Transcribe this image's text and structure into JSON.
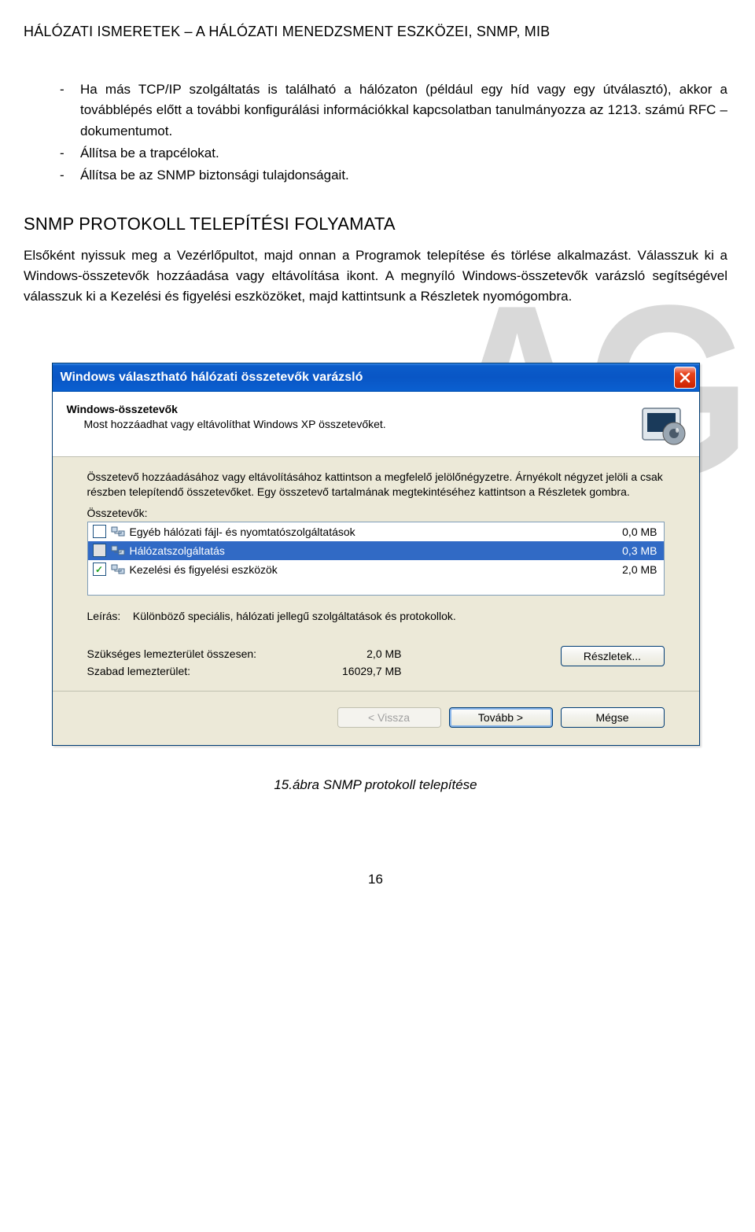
{
  "doc": {
    "header": "HÁLÓZATI ISMERETEK – A HÁLÓZATI MENEDZSMENT ESZKÖZEI, SNMP, MIB",
    "bullets": [
      "Ha más TCP/IP szolgáltatás is található a hálózaton (például egy híd vagy egy útválasztó), akkor a továbblépés előtt a további konfigurálási információkkal kapcsolatban tanulmányozza az 1213. számú RFC – dokumentumot.",
      "Állítsa be a trapcélokat.",
      "Állítsa be az SNMP biztonsági tulajdonságait."
    ],
    "section_heading": "SNMP PROTOKOLL TELEPÍTÉSI FOLYAMATA",
    "para1": "Elsőként nyissuk meg a Vezérlőpultot, majd onnan a Programok telepítése és törlése alkalmazást. Válasszuk ki a Windows-összetevők hozzáadása vagy eltávolítása ikont. A megnyíló Windows-összetevők varázsló segítségével válasszuk ki a Kezelési és figyelési eszközöket, majd kattintsunk a Részletek nyomógombra.",
    "caption": "15.ábra SNMP protokoll telepítése",
    "pagenum": "16",
    "watermark": "AG"
  },
  "dialog": {
    "title": "Windows választható hálózati összetevők varázsló",
    "banner_title": "Windows-összetevők",
    "banner_sub": "Most hozzáadhat vagy eltávolíthat Windows XP összetevőket.",
    "instructions": "Összetevő hozzáadásához vagy eltávolításához kattintson a megfelelő jelölőnégyzetre. Árnyékolt négyzet jelöli a csak részben telepítendő összetevőket. Egy összetevő tartalmának megtekintéséhez kattintson a Részletek gombra.",
    "list_label": "Összetevők:",
    "items": [
      {
        "label": "Egyéb hálózati fájl- és nyomtatószolgáltatások",
        "size": "0,0 MB",
        "checked": false,
        "gray": false,
        "selected": false
      },
      {
        "label": "Hálózatszolgáltatás",
        "size": "0,3 MB",
        "checked": false,
        "gray": true,
        "selected": true
      },
      {
        "label": "Kezelési és figyelési eszközök",
        "size": "2,0 MB",
        "checked": true,
        "gray": false,
        "selected": false
      }
    ],
    "desc_label": "Leírás:",
    "desc_text": "Különböző speciális, hálózati jellegű szolgáltatások és protokollok.",
    "req_label": "Szükséges lemezterület összesen:",
    "req_value": "2,0 MB",
    "free_label": "Szabad lemezterület:",
    "free_value": "16029,7 MB",
    "details_btn": "Részletek...",
    "back_btn": "< Vissza",
    "next_btn": "Tovább >",
    "cancel_btn": "Mégse"
  }
}
